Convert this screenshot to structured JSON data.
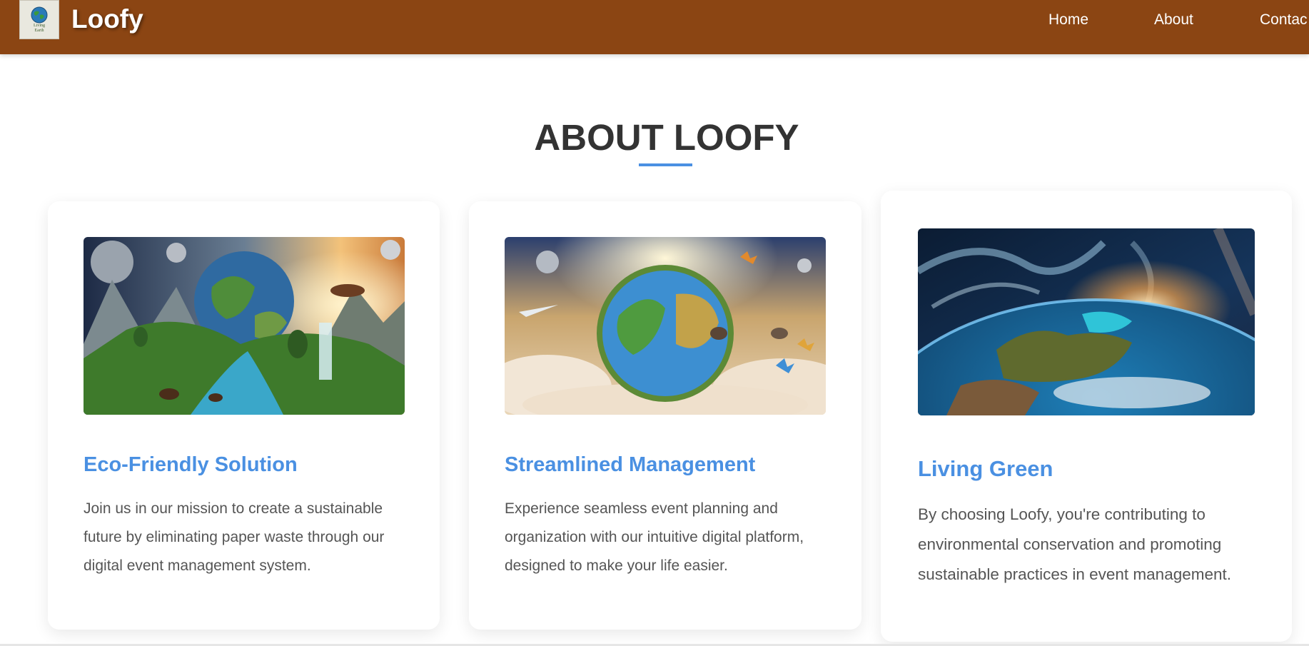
{
  "header": {
    "logo_text": [
      "Living",
      "Earth"
    ],
    "brand": "Loofy",
    "nav": [
      {
        "label": "Home"
      },
      {
        "label": "About"
      },
      {
        "label": "Contac"
      }
    ]
  },
  "about": {
    "title": "ABOUT LOOFY",
    "cards": [
      {
        "heading": "Eco-Friendly Solution",
        "text": "Join us in our mission to create a sustainable future by eliminating paper waste through our digital event management system.",
        "image": "earth-wildlife-fantasy-image"
      },
      {
        "heading": "Streamlined Management",
        "text": "Experience seamless event planning and organization with our intuitive digital platform, designed to make your life easier.",
        "image": "earth-clouds-butterflies-image"
      },
      {
        "heading": "Living Green",
        "text": "By choosing Loofy, you're contributing to environmental conservation and promoting sustainable practices in event management.",
        "image": "earth-from-space-image"
      }
    ]
  },
  "colors": {
    "header_bg": "#8b4513",
    "accent": "#4a90e2",
    "title": "#333333",
    "body_text": "#555555"
  }
}
